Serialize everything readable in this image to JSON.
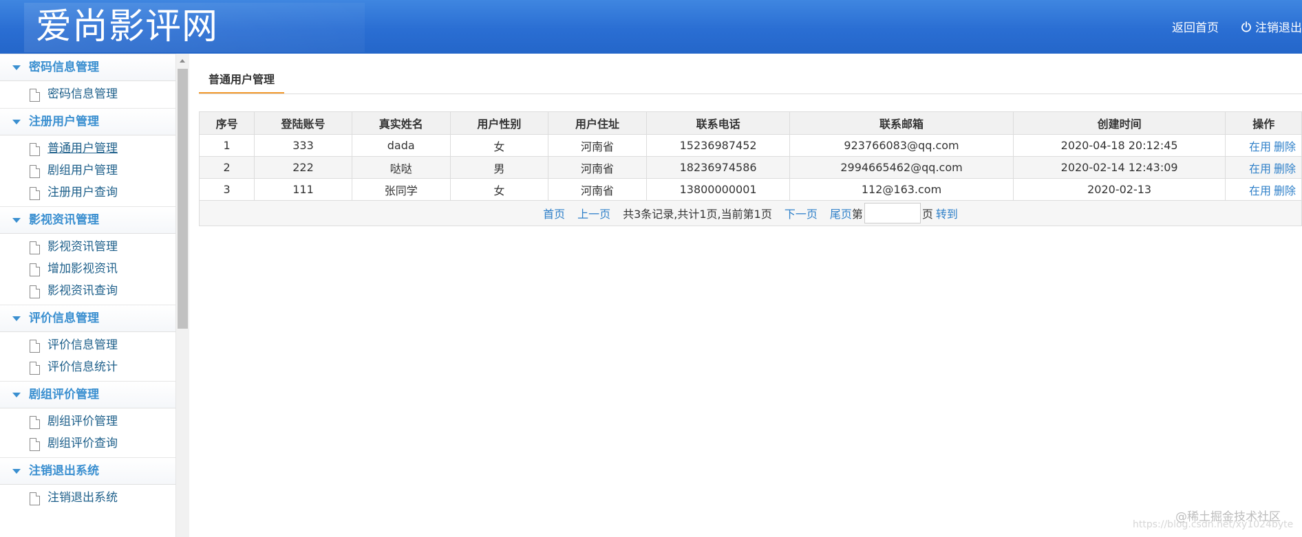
{
  "header": {
    "logo": "爱尚影评网",
    "home_link": "返回首页",
    "logout_link": "注销退出"
  },
  "sidebar": {
    "groups": [
      {
        "title": "密码信息管理",
        "items": [
          "密码信息管理"
        ]
      },
      {
        "title": "注册用户管理",
        "items": [
          "普通用户管理",
          "剧组用户管理",
          "注册用户查询"
        ]
      },
      {
        "title": "影视资讯管理",
        "items": [
          "影视资讯管理",
          "增加影视资讯",
          "影视资讯查询"
        ]
      },
      {
        "title": "评价信息管理",
        "items": [
          "评价信息管理",
          "评价信息统计"
        ]
      },
      {
        "title": "剧组评价管理",
        "items": [
          "剧组评价管理",
          "剧组评价查询"
        ]
      },
      {
        "title": "注销退出系统",
        "items": [
          "注销退出系统"
        ]
      }
    ]
  },
  "main": {
    "tab": "普通用户管理",
    "columns": [
      "序号",
      "登陆账号",
      "真实姓名",
      "用户性别",
      "用户住址",
      "联系电话",
      "联系邮箱",
      "创建时间",
      "操作"
    ],
    "rows": [
      {
        "idx": "1",
        "account": "333",
        "name": "dada",
        "gender": "女",
        "address": "河南省",
        "phone": "15236987452",
        "email": "923766083@qq.com",
        "created": "2020-04-18 20:12:45",
        "op_use": "在用",
        "op_delete": "删除"
      },
      {
        "idx": "2",
        "account": "222",
        "name": "哒哒",
        "gender": "男",
        "address": "河南省",
        "phone": "18236974586",
        "email": "2994665462@qq.com",
        "created": "2020-02-14 12:43:09",
        "op_use": "在用",
        "op_delete": "删除"
      },
      {
        "idx": "3",
        "account": "111",
        "name": "张同学",
        "gender": "女",
        "address": "河南省",
        "phone": "13800000001",
        "email": "112@163.com",
        "created": "2020-02-13",
        "op_use": "在用",
        "op_delete": "删除"
      }
    ],
    "pager": {
      "first": "首页",
      "prev": "上一页",
      "info": "共3条记录,共计1页,当前第1页",
      "next": "下一页",
      "last": "尾页",
      "page_prefix": "第",
      "page_value": "",
      "page_suffix": "页",
      "go": "转到"
    }
  },
  "watermark": {
    "text": "@稀土掘金技术社区",
    "url": "https://blog.csdn.net/xy1024byte"
  }
}
